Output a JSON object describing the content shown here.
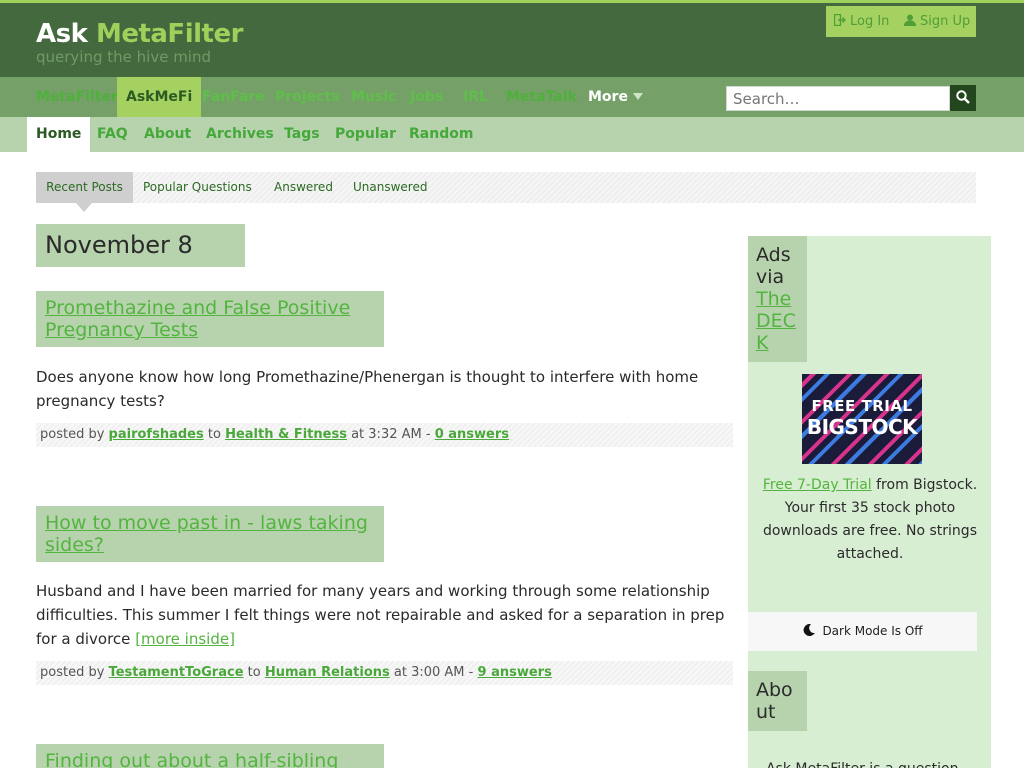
{
  "header": {
    "brand_plain": "Ask",
    "brand_accent": "MetaFilter",
    "tagline": "querying the hive mind",
    "login": "Log In",
    "signup": "Sign Up"
  },
  "site_nav": {
    "items": [
      "MetaFilter",
      "AskMeFi",
      "FanFare",
      "Projects",
      "Music",
      "Jobs",
      "IRL",
      "MetaTalk"
    ],
    "more": "More",
    "search_placeholder": "Search…"
  },
  "sub_nav": {
    "items": [
      "Home",
      "FAQ",
      "About",
      "Archives",
      "Tags",
      "Popular",
      "Random"
    ]
  },
  "tabs": [
    "Recent Posts",
    "Popular Questions",
    "Answered",
    "Unanswered"
  ],
  "date_heading": "November 8",
  "questions": [
    {
      "title": "Promethazine and False Positive Pregnancy Tests",
      "body": "Does anyone know how long Promethazine/Phenergan is thought to interfere with home pregnancy tests?",
      "more": "",
      "posted_by_label": "posted by",
      "user": "pairofshades",
      "to_label": "to",
      "category": "Health & Fitness",
      "time": "at 3:32 AM -",
      "answers": "0 answers"
    },
    {
      "title": "How to move past in - laws taking sides?",
      "body": "Husband and I have been married for many years and working through some relationship difficulties. This summer I felt things were not repairable and asked for a separation in prep for a divorce",
      "more": "[more inside]",
      "posted_by_label": "posted by",
      "user": "TestamentToGrace",
      "to_label": "to",
      "category": "Human Relations",
      "time": "at 3:00 AM -",
      "answers": "9 answers"
    },
    {
      "title": "Finding out about a half-sibling",
      "body": "",
      "more": "",
      "posted_by_label": "",
      "user": "",
      "to_label": "",
      "category": "",
      "time": "",
      "answers": ""
    }
  ],
  "sidebar": {
    "ads_heading_plain": "Ads via",
    "ads_heading_accent": "The DECK",
    "ad_image_line1": "FREE TRIAL",
    "ad_image_line2": "BIGSTOCK",
    "ad_link": "Free 7-Day Trial",
    "ad_text": "from Bigstock. Your first 35 stock photo downloads are free. No strings attached.",
    "dark_mode": "Dark Mode Is Off",
    "about_heading": "About",
    "about_text": "Ask MetaFilter is a question"
  },
  "colors": {
    "header_bg": "#44693f",
    "accent_green": "#9ed05b",
    "link_green": "#53b43f",
    "nav_bg": "#75a068",
    "subnav_bg": "#b7d3ae",
    "sidebar_bg": "#d8eed3"
  },
  "icons": {
    "login": "login-arrow-icon",
    "signup": "user-icon",
    "search": "search-icon",
    "more": "caret-down-icon",
    "dark_mode": "moon-icon"
  }
}
